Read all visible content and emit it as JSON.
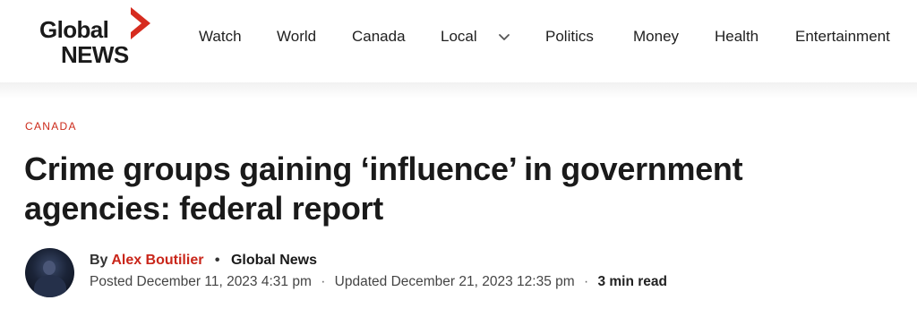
{
  "header": {
    "logo": {
      "line1": "Global",
      "line2": "NEWS",
      "brand_color": "#d62c1f"
    },
    "nav": [
      {
        "label": "Watch"
      },
      {
        "label": "World"
      },
      {
        "label": "Canada"
      },
      {
        "label": "Local",
        "has_dropdown": true,
        "dropdown_icon": "chevron-down-icon"
      },
      {
        "label": "Politics"
      },
      {
        "label": "Money"
      },
      {
        "label": "Health"
      },
      {
        "label": "Entertainment"
      }
    ]
  },
  "article": {
    "section": "CANADA",
    "title": "Crime groups gaining ‘influence’ in government agencies: federal report",
    "byline": {
      "prefix": "By",
      "author": "Alex Boutilier",
      "separator": "•",
      "source": "Global News"
    },
    "meta": {
      "posted": "Posted December 11, 2023 4:31 pm",
      "separator": "·",
      "updated": "Updated December 21, 2023 12:35 pm",
      "read_time": "3 min read"
    },
    "accent_color": "#c9261a"
  }
}
